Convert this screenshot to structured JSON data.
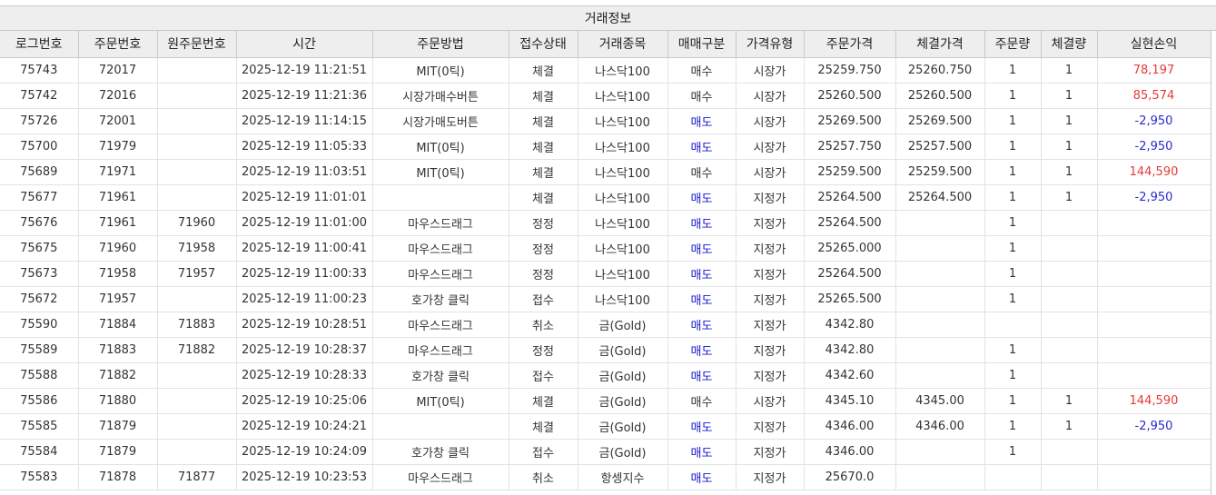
{
  "section_title": "거래정보",
  "columns": [
    "로그번호",
    "주문번호",
    "원주문번호",
    "시간",
    "주문방법",
    "접수상태",
    "거래종목",
    "매매구분",
    "가격유형",
    "주문가격",
    "체결가격",
    "주문량",
    "체결량",
    "실현손익"
  ],
  "rows": [
    [
      "75743",
      "72017",
      "",
      "2025-12-19 11:21:51",
      "MIT(0틱)",
      "체결",
      "나스닥100",
      "매수",
      "시장가",
      "25259.750",
      "25260.750",
      "1",
      "1",
      "78,197"
    ],
    [
      "75742",
      "72016",
      "",
      "2025-12-19 11:21:36",
      "시장가매수버튼",
      "체결",
      "나스닥100",
      "매수",
      "시장가",
      "25260.500",
      "25260.500",
      "1",
      "1",
      "85,574"
    ],
    [
      "75726",
      "72001",
      "",
      "2025-12-19 11:14:15",
      "시장가매도버튼",
      "체결",
      "나스닥100",
      "매도",
      "시장가",
      "25269.500",
      "25269.500",
      "1",
      "1",
      "-2,950"
    ],
    [
      "75700",
      "71979",
      "",
      "2025-12-19 11:05:33",
      "MIT(0틱)",
      "체결",
      "나스닥100",
      "매도",
      "시장가",
      "25257.750",
      "25257.500",
      "1",
      "1",
      "-2,950"
    ],
    [
      "75689",
      "71971",
      "",
      "2025-12-19 11:03:51",
      "MIT(0틱)",
      "체결",
      "나스닥100",
      "매수",
      "시장가",
      "25259.500",
      "25259.500",
      "1",
      "1",
      "144,590"
    ],
    [
      "75677",
      "71961",
      "",
      "2025-12-19 11:01:01",
      "",
      "체결",
      "나스닥100",
      "매도",
      "지정가",
      "25264.500",
      "25264.500",
      "1",
      "1",
      "-2,950"
    ],
    [
      "75676",
      "71961",
      "71960",
      "2025-12-19 11:01:00",
      "마우스드래그",
      "정정",
      "나스닥100",
      "매도",
      "지정가",
      "25264.500",
      "",
      "1",
      "",
      ""
    ],
    [
      "75675",
      "71960",
      "71958",
      "2025-12-19 11:00:41",
      "마우스드래그",
      "정정",
      "나스닥100",
      "매도",
      "지정가",
      "25265.000",
      "",
      "1",
      "",
      ""
    ],
    [
      "75673",
      "71958",
      "71957",
      "2025-12-19 11:00:33",
      "마우스드래그",
      "정정",
      "나스닥100",
      "매도",
      "지정가",
      "25264.500",
      "",
      "1",
      "",
      ""
    ],
    [
      "75672",
      "71957",
      "",
      "2025-12-19 11:00:23",
      "호가창 클릭",
      "접수",
      "나스닥100",
      "매도",
      "지정가",
      "25265.500",
      "",
      "1",
      "",
      ""
    ],
    [
      "75590",
      "71884",
      "71883",
      "2025-12-19 10:28:51",
      "마우스드래그",
      "취소",
      "금(Gold)",
      "매도",
      "지정가",
      "4342.80",
      "",
      "",
      "",
      ""
    ],
    [
      "75589",
      "71883",
      "71882",
      "2025-12-19 10:28:37",
      "마우스드래그",
      "정정",
      "금(Gold)",
      "매도",
      "지정가",
      "4342.80",
      "",
      "1",
      "",
      ""
    ],
    [
      "75588",
      "71882",
      "",
      "2025-12-19 10:28:33",
      "호가창 클릭",
      "접수",
      "금(Gold)",
      "매도",
      "지정가",
      "4342.60",
      "",
      "1",
      "",
      ""
    ],
    [
      "75586",
      "71880",
      "",
      "2025-12-19 10:25:06",
      "MIT(0틱)",
      "체결",
      "금(Gold)",
      "매수",
      "시장가",
      "4345.10",
      "4345.00",
      "1",
      "1",
      "144,590"
    ],
    [
      "75585",
      "71879",
      "",
      "2025-12-19 10:24:21",
      "",
      "체결",
      "금(Gold)",
      "매도",
      "지정가",
      "4346.00",
      "4346.00",
      "1",
      "1",
      "-2,950"
    ],
    [
      "75584",
      "71879",
      "",
      "2025-12-19 10:24:09",
      "호가창 클릭",
      "접수",
      "금(Gold)",
      "매도",
      "지정가",
      "4346.00",
      "",
      "1",
      "",
      ""
    ],
    [
      "75583",
      "71878",
      "71877",
      "2025-12-19 10:23:53",
      "마우스드래그",
      "취소",
      "항셍지수",
      "매도",
      "지정가",
      "25670.0",
      "",
      "",
      "",
      ""
    ]
  ],
  "colors": {
    "sell": "#1a1acc",
    "profit": "#e63a3a",
    "loss": "#2a2ad0",
    "header_bg": "#eeeeee"
  }
}
